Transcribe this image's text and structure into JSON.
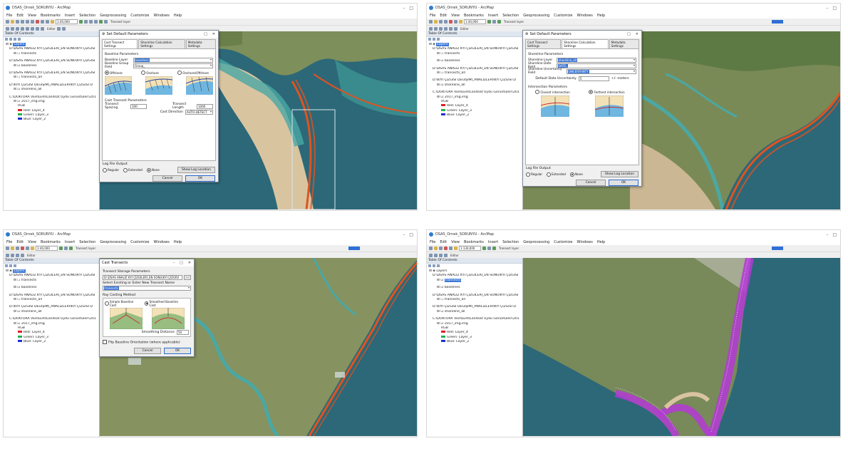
{
  "panels": [
    {
      "title": "DSAS_Ornek_SORUNYU - ArcMap",
      "menu": [
        "File",
        "Edit",
        "View",
        "Bookmarks",
        "Insert",
        "Selection",
        "Geoprocessing",
        "Customize",
        "Windows",
        "Help"
      ],
      "scale": "1:40,000",
      "target_layer_label": "Transect layer",
      "editor_label": "Editor",
      "toc_title": "Table Of Contents",
      "layers": {
        "root": "Layers",
        "g1": "D:\\DSAS ANALİZ KYI ÇİZGİLERİ_EN SONU\\KYI ÇİZGİSİ",
        "g1_item": "transects",
        "g2": "D:\\DSAS ANALİZ KYI ÇİZGİLERİ_EN SONU\\KYI ÇİZGİSİ",
        "g2_item": "baselines",
        "g3": "D:\\DSAS ANALİZ KYI ÇİZGİLERİ_EN SONU\\KYI ÇİZGİSİ",
        "g3_item": "transects_all",
        "g4": "D:\\KIYI ÇİZGİSİ DEĞİŞİMİ_ANALİZLERİ\\KYI ÇİZGİSİ D",
        "g4_item": "shoreline_all",
        "g5": "C:\\DOKTORA VERİLERİ\\Landsat Uydu Görüntüleri\\201",
        "raster": "2017_img.img",
        "rgb": "RGB",
        "red": "Red:   Layer_4",
        "green": "Green: Layer_3",
        "blue": "Blue:  Layer_2"
      },
      "dialog": {
        "title": "Set Default Parameters",
        "tabs": [
          "Cast Transect Settings",
          "Shoreline Calculation Settings",
          "Metadata Settings"
        ],
        "baseline_params": "Baseline Parameters",
        "baseline_layer_label": "Baseline Layer",
        "baseline_layer_value": "baselines",
        "baseline_group_label": "Baseline Group Field",
        "baseline_group_value": "Group_",
        "offshore": "Offshore",
        "onshore": "Onshore",
        "onoff": "Onshore/Offshore",
        "transect_params": "Cast Transect Parameters",
        "spacing_label": "Transect Spacing",
        "spacing_value": "100",
        "length_label": "Transect Length",
        "length_value": "1000",
        "direction_label": "Cast Direction",
        "direction_value": "AUTO-DETECT",
        "log_title": "Log File Output",
        "log_regular": "Regular",
        "log_extended": "Extended",
        "log_none": "None",
        "show_log": "Show Log Location",
        "cancel": "Cancel",
        "ok": "OK"
      }
    },
    {
      "title": "DSAS_Ornek_SORUNYU - ArcMap",
      "dialog": {
        "title": "Set Default Parameters",
        "tabs": [
          "Cast Transect Settings",
          "Shoreline Calculation Settings",
          "Metadata Settings"
        ],
        "shoreline_params": "Shoreline Parameters",
        "shoreline_layer_label": "Shoreline Layer",
        "shoreline_layer_value": "shoreline_all",
        "date_field_label": "Shoreline Date Field",
        "date_field_value": "DATE_",
        "uncert_field_label": "Shoreline Uncertainty Field",
        "uncert_field_value": "UNCERTAINTY",
        "default_uncert_label": "Default Data Uncertainty",
        "default_uncert_value": "5",
        "meters": "+/- meters",
        "intersection_params": "Intersection Parameters",
        "closest": "Closest intersection",
        "farthest": "Farthest intersection",
        "log_title": "Log File Output",
        "log_regular": "Regular",
        "log_extended": "Extended",
        "log_none": "None",
        "show_log": "Show Log Location",
        "cancel": "Cancel",
        "ok": "OK"
      }
    },
    {
      "title": "DSAS_Ornek_SORUNYU - ArcMap",
      "dialog": {
        "title": "Cast Transects",
        "storage_params": "Transect Storage Parameters",
        "storage_value": "D:\\DSAS ANALİZ KYI ÇİZGİLERİ_EN SONU\\KYI ÇİZGİSİ",
        "browse": "...",
        "select_label": "Select Existing or Enter New Transect Name",
        "select_value": "transects",
        "method_title": "Ray Casting Method",
        "simple": "Simple Baseline Cast",
        "smoothed": "Smoothed Baseline Cast",
        "smoothing_label": "Smoothing Distance",
        "smoothing_value": "50",
        "flip": "Flip Baseline Orientation (where applicable)",
        "cancel": "Cancel",
        "ok": "OK"
      }
    },
    {
      "title": "DSAS_Ornek_SORUNYU - ArcMap",
      "scale": "1:130,000",
      "selected_layer": "transects"
    }
  ],
  "colors": {
    "shoreline": "#e0531f",
    "transects": "#b43ad6",
    "selection": "#3a75d3",
    "sea": "#2f6f80",
    "lagoon": "#4aa8a4"
  }
}
